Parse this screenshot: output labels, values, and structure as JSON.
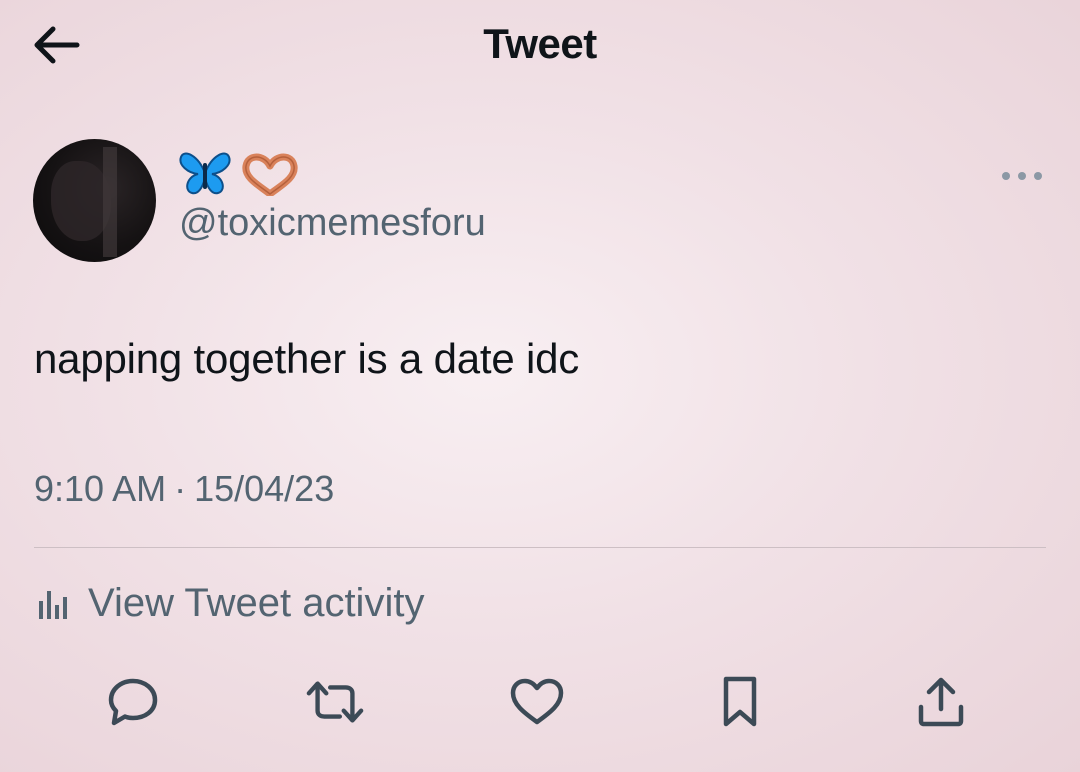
{
  "header": {
    "title": "Tweet",
    "back_icon": "arrow-left-icon"
  },
  "author": {
    "display_name_emojis": [
      "butterfly-icon",
      "heart-hands-icon"
    ],
    "handle": "@toxicmemesforu"
  },
  "tweet": {
    "text": "napping together is a date idc",
    "time": "9:10 AM",
    "separator": "·",
    "date": "15/04/23"
  },
  "activity": {
    "label": "View Tweet activity",
    "icon": "bar-chart-icon"
  },
  "actions": [
    "reply-icon",
    "retweet-icon",
    "like-icon",
    "bookmark-icon",
    "share-icon"
  ],
  "colors": {
    "text_primary": "#0f1419",
    "text_secondary": "#536471",
    "butterfly": "#1d9bf0",
    "heart_hands": "#d9825b"
  }
}
